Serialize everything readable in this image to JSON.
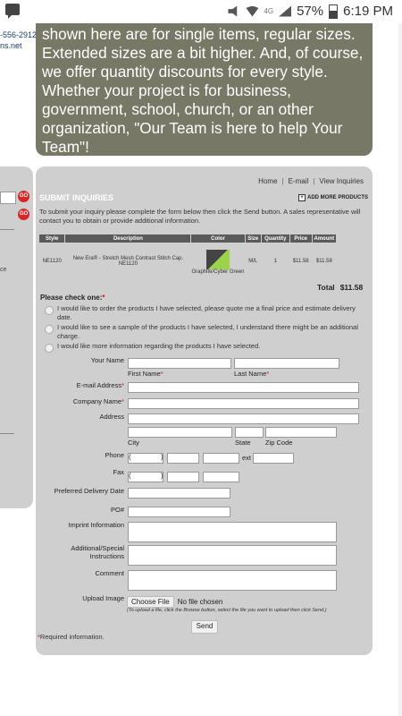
{
  "status": {
    "battery": "57%",
    "time": "6:19 PM",
    "network": "4G"
  },
  "left": {
    "phone": "-556-2912",
    "web": "ns.net",
    "go1": "GO",
    "go2": "GO",
    "side_text": "ce"
  },
  "topbox": {
    "text": "shown here are for single items, regular sizes. Extended sizes are a bit higher. And, of course, we offer quantity discounts for every style. Whether your project is for business, government, school, church, or an other organization, \"Our Team is here to help Your Team\"!"
  },
  "nav": {
    "home": "Home",
    "email": "E-mail",
    "view": "View Inquiries"
  },
  "form": {
    "heading": "SUBMIT INQUIRIES",
    "add_more": "ADD MORE PRODUCTS",
    "intro": "To submit your inquiry please complete the form below then click the Send button. A sales representative will contact you to obtain or provide additional information.",
    "columns": [
      "Style",
      "Description",
      "Color",
      "Size",
      "Quantity",
      "Price",
      "Amount"
    ],
    "item": {
      "style": "NE1120",
      "description": "New Era® - Stretch Mesh Contrast Stitch Cap. NE1120",
      "color_name": "Graphite/Cyber Green",
      "size": "M/L",
      "quantity": "1",
      "price": "$11.58",
      "amount": "$11.58",
      "swatch_colors": [
        "#444444",
        "#9bd34b"
      ]
    },
    "total_label": "Total",
    "total_value": "$11.58",
    "check_one": "Please check one:",
    "required_mark": "*",
    "options": [
      "I would like to order the products I have selected, please quote me a final price and estimate delivery date.",
      "I would like to see a sample of the products I have selected, I understand there might be an additional charge.",
      "I would like more information regarding the products I have selected."
    ],
    "labels": {
      "your_name": "Your Name",
      "first_name": "First Name",
      "last_name": "Last Name",
      "email": "E-mail Address",
      "company": "Company Name",
      "address": "Address",
      "city": "City",
      "state": "State",
      "zip": "Zip Code",
      "phone": "Phone",
      "ext": "ext",
      "fax": "Fax",
      "delivery": "Preferred Delivery Date",
      "po": "PO#",
      "imprint": "Imprint Information",
      "additional": "Additional/Special Instructions",
      "comment": "Comment",
      "upload": "Upload Image"
    },
    "choose_file": "Choose File",
    "no_file": "No file chosen",
    "upload_hint": "(To upload a file, click the Browse button, select the file you want to upload then click Send.)",
    "send": "Send",
    "required_info": "Required information."
  }
}
